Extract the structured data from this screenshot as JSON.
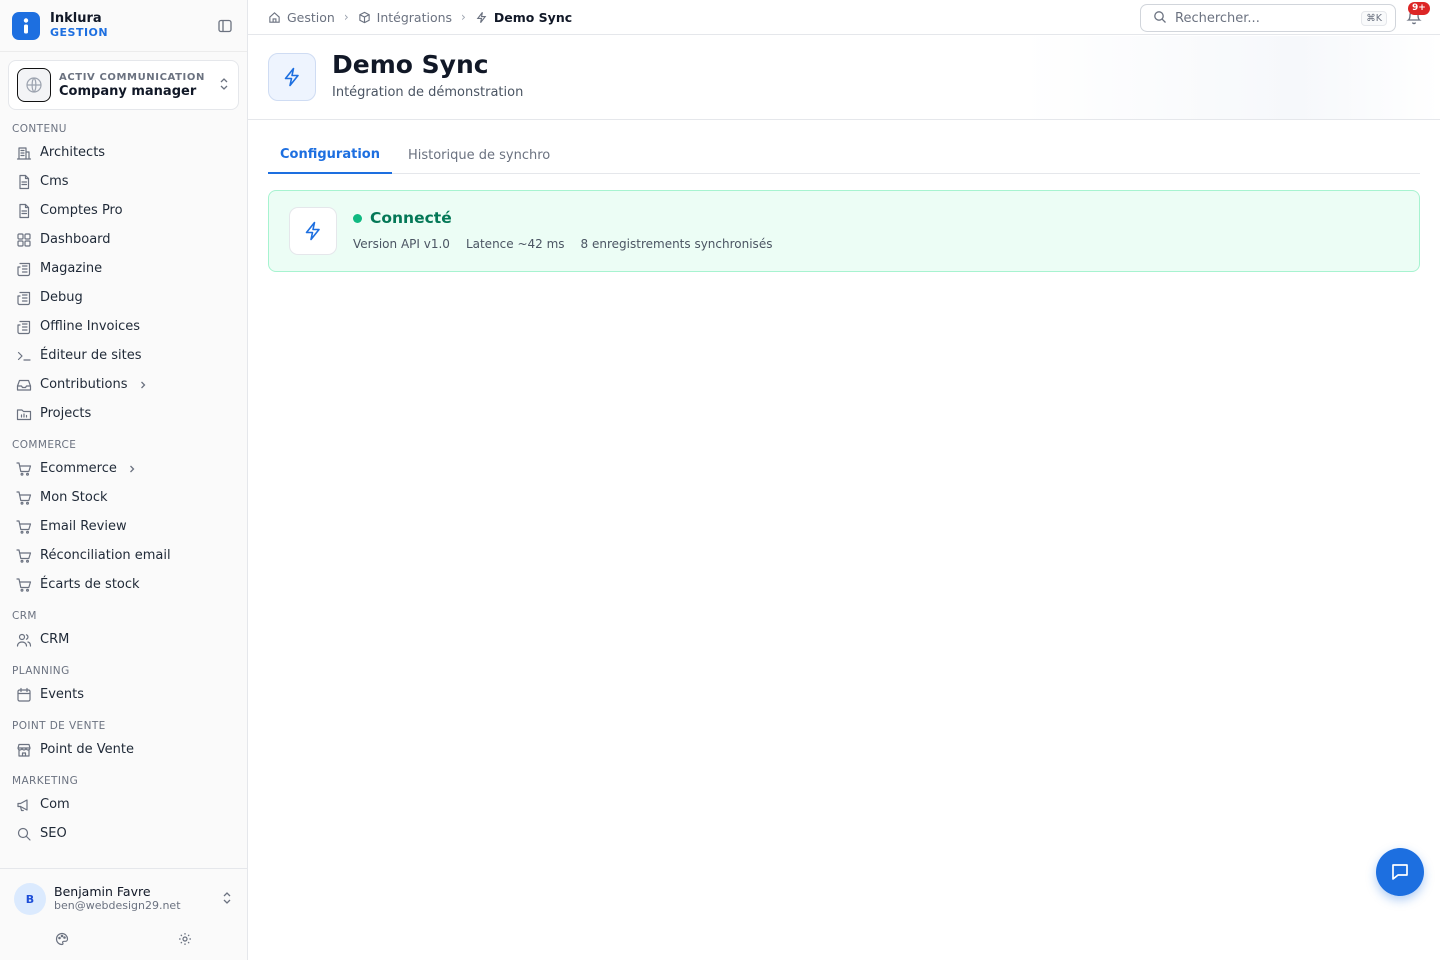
{
  "brand": {
    "name": "Inklura",
    "subtitle": "GESTION"
  },
  "org": {
    "kicker": "ACTIV COMMUNICATION",
    "name": "Company manager"
  },
  "sidebar": {
    "sections": [
      {
        "title": "CONTENU",
        "items": [
          {
            "label": "Architects",
            "icon": "building-icon"
          },
          {
            "label": "Cms",
            "icon": "file-icon"
          },
          {
            "label": "Comptes Pro",
            "icon": "file-icon"
          },
          {
            "label": "Dashboard",
            "icon": "grid-icon"
          },
          {
            "label": "Magazine",
            "icon": "newspaper-icon"
          },
          {
            "label": "Debug",
            "icon": "newspaper-icon"
          },
          {
            "label": "Offline Invoices",
            "icon": "newspaper-icon"
          },
          {
            "label": "Éditeur de sites",
            "icon": "terminal-icon"
          },
          {
            "label": "Contributions",
            "icon": "inbox-icon",
            "expandable": true
          },
          {
            "label": "Projects",
            "icon": "folder-chart-icon"
          }
        ]
      },
      {
        "title": "COMMERCE",
        "items": [
          {
            "label": "Ecommerce",
            "icon": "cart-icon",
            "expandable": true
          },
          {
            "label": "Mon Stock",
            "icon": "cart-icon"
          },
          {
            "label": "Email Review",
            "icon": "cart-icon"
          },
          {
            "label": "Réconciliation email",
            "icon": "cart-icon"
          },
          {
            "label": "Écarts de stock",
            "icon": "cart-icon"
          }
        ]
      },
      {
        "title": "CRM",
        "items": [
          {
            "label": "CRM",
            "icon": "users-icon"
          }
        ]
      },
      {
        "title": "PLANNING",
        "items": [
          {
            "label": "Events",
            "icon": "calendar-icon"
          }
        ]
      },
      {
        "title": "POINT DE VENTE",
        "items": [
          {
            "label": "Point de Vente",
            "icon": "store-icon"
          }
        ]
      },
      {
        "title": "MARKETING",
        "items": [
          {
            "label": "Com",
            "icon": "megaphone-icon"
          },
          {
            "label": "SEO",
            "icon": "search-icon"
          }
        ]
      }
    ]
  },
  "user": {
    "initial": "B",
    "name": "Benjamin Favre",
    "email": "ben@webdesign29.net"
  },
  "breadcrumb": {
    "items": [
      "Gestion",
      "Intégrations",
      "Demo Sync"
    ]
  },
  "search": {
    "placeholder": "Rechercher...",
    "shortcut": "⌘K"
  },
  "notifications": {
    "badge": "9+"
  },
  "header": {
    "title": "Demo Sync",
    "subtitle": "Intégration de démonstration"
  },
  "tabs": [
    "Configuration",
    "Historique de synchro"
  ],
  "status": {
    "label": "Connecté",
    "color": "#10b981",
    "meta": [
      "Version API v1.0",
      "Latence ~42 ms",
      "8 enregistrements synchronisés"
    ]
  },
  "colors": {
    "accent": "#1d6fe0",
    "success": "#047857",
    "danger": "#dc2626"
  }
}
